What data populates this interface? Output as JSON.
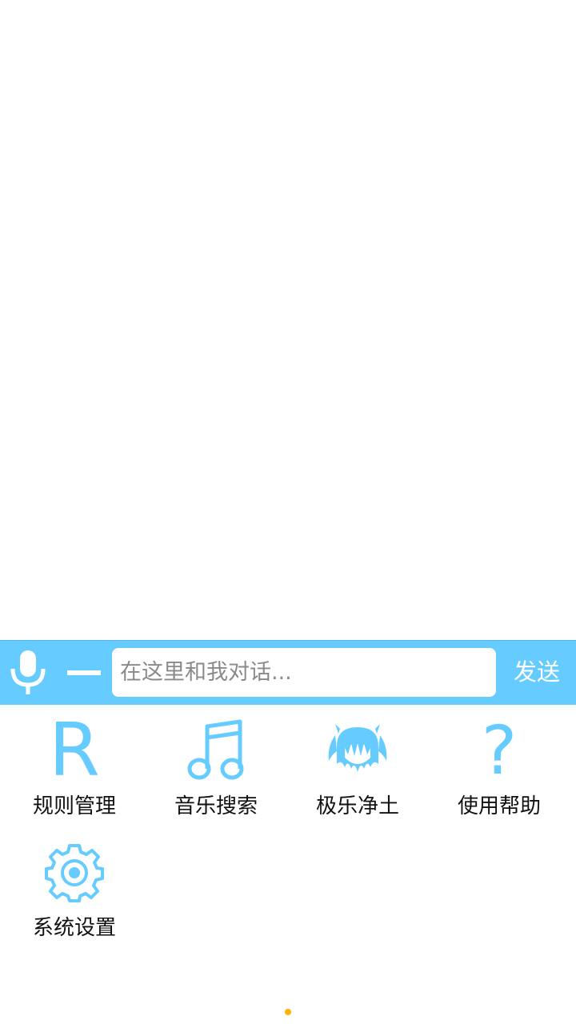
{
  "colors": {
    "accent": "#66ccff",
    "background": "#ffffff",
    "label_text": "#111111",
    "page_indicator": "#ffb300"
  },
  "input_bar": {
    "mic_icon": "microphone-icon",
    "minus_icon": "minus-icon",
    "input_placeholder": "在这里和我对话...",
    "input_value": "",
    "send_label": "发送"
  },
  "menu": {
    "items": [
      {
        "label": "规则管理",
        "icon": "letter-r-icon"
      },
      {
        "label": "音乐搜索",
        "icon": "music-note-icon"
      },
      {
        "label": "极乐净土",
        "icon": "anime-girl-icon"
      },
      {
        "label": "使用帮助",
        "icon": "question-mark-icon"
      },
      {
        "label": "系统设置",
        "icon": "gear-icon"
      }
    ],
    "r_glyph": "R",
    "q_glyph": "?"
  },
  "pager": {
    "current_page": 1,
    "page_count": 1
  }
}
